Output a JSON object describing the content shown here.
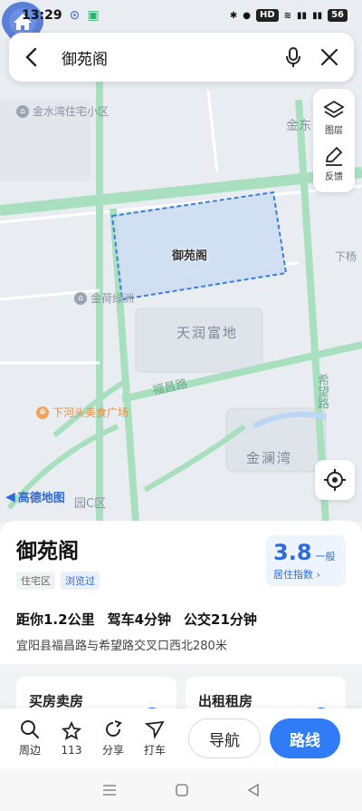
{
  "status": {
    "time": "13:29",
    "network": "HD",
    "battery": "56"
  },
  "search": {
    "query": "御苑阁"
  },
  "side_tools": {
    "layers_label": "图层",
    "feedback_label": "反馈"
  },
  "map": {
    "marker_label": "御苑阁",
    "labels": {
      "area1": "金水湾住宅小区",
      "area2": "金荷绿洲",
      "area3": "天润富地",
      "area4": "下河头美食广场",
      "area5": "金澜湾",
      "road1": "福昌路",
      "road2": "希望路",
      "edge1": "金东",
      "edge2": "下杨",
      "bottom_left": "园C区"
    },
    "brand": "高德地图"
  },
  "place": {
    "name": "御苑阁",
    "tags": [
      "住宅区",
      "浏览过"
    ],
    "score": "3.8",
    "score_tier": "一般",
    "score_label": "居住指数 ›",
    "distance": "距你1.2公里",
    "drive": "驾车4分钟",
    "bus": "公交21分钟",
    "address": "宜阳县福昌路与希望路交叉口西北280米"
  },
  "services": {
    "buy_sell": "买房卖房",
    "rent": "出租租房"
  },
  "actions": {
    "nearby": "周边",
    "favorite_count": "113",
    "share": "分享",
    "taxi": "打车",
    "navigate": "导航",
    "route": "路线"
  },
  "colors": {
    "accent": "#2f7cf6",
    "road_green": "#a8e0bf",
    "polygon_fill": "#cddcf3",
    "polygon_border": "#3b7de0"
  }
}
